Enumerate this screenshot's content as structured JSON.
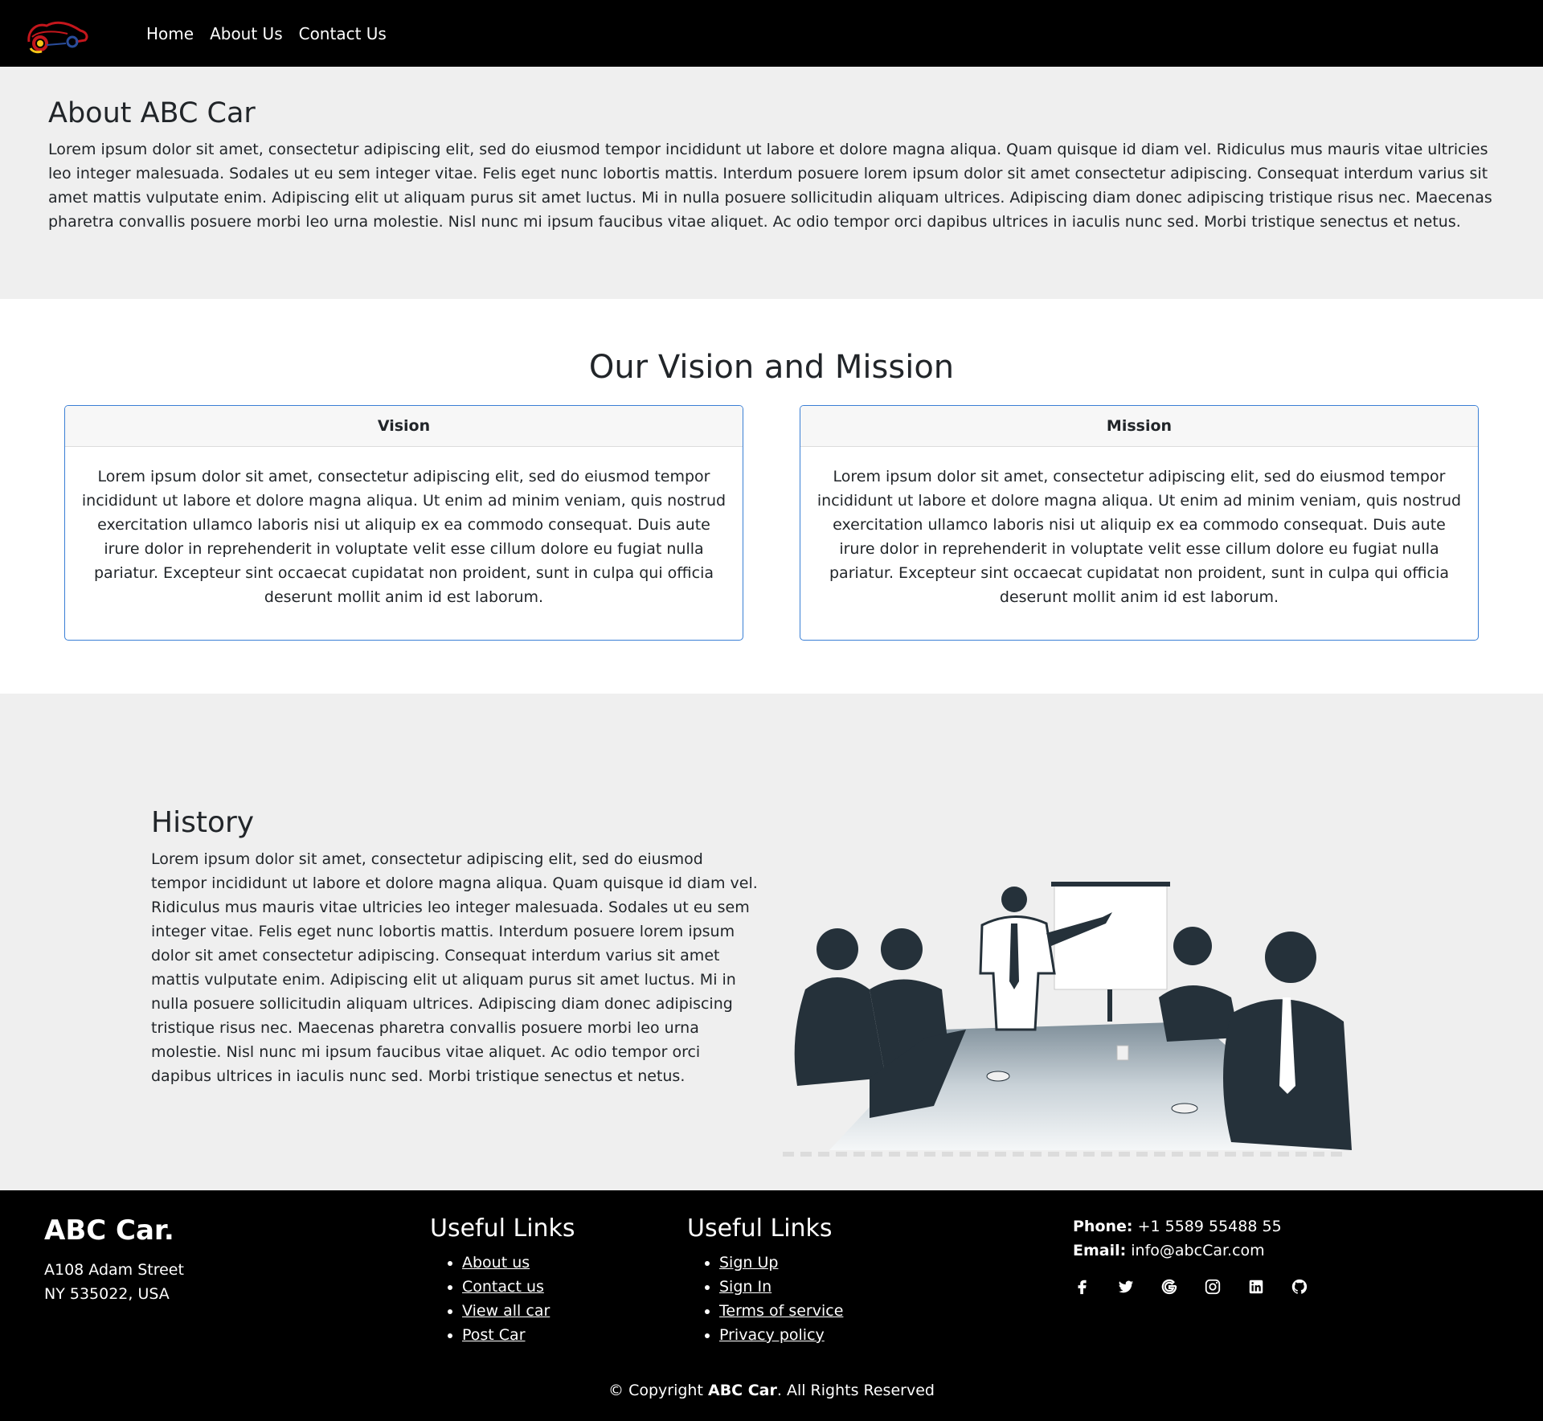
{
  "nav": {
    "logo_icon": "car-logo-icon",
    "links": [
      "Home",
      "About Us",
      "Contact Us"
    ]
  },
  "about": {
    "title": "About ABC Car",
    "text": "Lorem ipsum dolor sit amet, consectetur adipiscing elit, sed do eiusmod tempor incididunt ut labore et dolore magna aliqua. Quam quisque id diam vel. Ridiculus mus mauris vitae ultricies leo integer malesuada. Sodales ut eu sem integer vitae. Felis eget nunc lobortis mattis. Interdum posuere lorem ipsum dolor sit amet consectetur adipiscing. Consequat interdum varius sit amet mattis vulputate enim. Adipiscing elit ut aliquam purus sit amet luctus. Mi in nulla posuere sollicitudin aliquam ultrices. Adipiscing diam donec adipiscing tristique risus nec. Maecenas pharetra convallis posuere morbi leo urna molestie. Nisl nunc mi ipsum faucibus vitae aliquet. Ac odio tempor orci dapibus ultrices in iaculis nunc sed. Morbi tristique senectus et netus."
  },
  "vision_mission": {
    "title": "Our Vision and Mission",
    "vision": {
      "header": "Vision",
      "text": "Lorem ipsum dolor sit amet, consectetur adipiscing elit, sed do eiusmod tempor incididunt ut labore et dolore magna aliqua. Ut enim ad minim veniam, quis nostrud exercitation ullamco laboris nisi ut aliquip ex ea commodo consequat. Duis aute irure dolor in reprehenderit in voluptate velit esse cillum dolore eu fugiat nulla pariatur. Excepteur sint occaecat cupidatat non proident, sunt in culpa qui officia deserunt mollit anim id est laborum."
    },
    "mission": {
      "header": "Mission",
      "text": "Lorem ipsum dolor sit amet, consectetur adipiscing elit, sed do eiusmod tempor incididunt ut labore et dolore magna aliqua. Ut enim ad minim veniam, quis nostrud exercitation ullamco laboris nisi ut aliquip ex ea commodo consequat. Duis aute irure dolor in reprehenderit in voluptate velit esse cillum dolore eu fugiat nulla pariatur. Excepteur sint occaecat cupidatat non proident, sunt in culpa qui officia deserunt mollit anim id est laborum."
    },
    "border_color": "#3a7fd5"
  },
  "history": {
    "title": "History",
    "text": "Lorem ipsum dolor sit amet, consectetur adipiscing elit, sed do eiusmod tempor incididunt ut labore et dolore magna aliqua. Quam quisque id diam vel. Ridiculus mus mauris vitae ultricies leo integer malesuada. Sodales ut eu sem integer vitae. Felis eget nunc lobortis mattis. Interdum posuere lorem ipsum dolor sit amet consectetur adipiscing. Consequat interdum varius sit amet mattis vulputate enim. Adipiscing elit ut aliquam purus sit amet luctus. Mi in nulla posuere sollicitudin aliquam ultrices. Adipiscing diam donec adipiscing tristique risus nec. Maecenas pharetra convallis posuere morbi leo urna molestie. Nisl nunc mi ipsum faucibus vitae aliquet. Ac odio tempor orci dapibus ultrices in iaculis nunc sed. Morbi tristique senectus et netus.",
    "image": "business-meeting-illustration"
  },
  "footer": {
    "brand": "ABC Car.",
    "address_line1": "A108 Adam Street",
    "address_line2": "NY 535022, USA",
    "links1": {
      "title": "Useful Links",
      "items": [
        "About us",
        "Contact us",
        "View all car",
        "Post Car"
      ]
    },
    "links2": {
      "title": "Useful Links",
      "items": [
        "Sign Up",
        "Sign In",
        "Terms of service",
        "Privacy policy"
      ]
    },
    "phone_label": "Phone:",
    "phone": "+1 5589 55488 55",
    "email_label": "Email:",
    "email": "info@abcCar.com",
    "socials": [
      "facebook-icon",
      "twitter-icon",
      "google-icon",
      "instagram-icon",
      "linkedin-icon",
      "github-icon"
    ],
    "copyright_prefix": "© Copyright",
    "copyright_brand": "ABC Car",
    "copyright_suffix": ". All Rights Reserved"
  }
}
